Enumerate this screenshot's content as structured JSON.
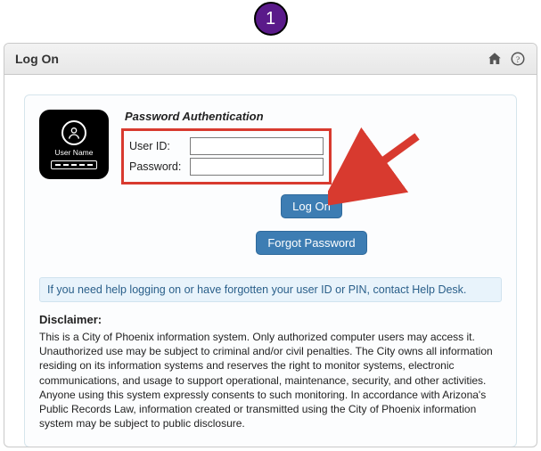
{
  "step_badge": "1",
  "panel": {
    "title": "Log On"
  },
  "user_tile": {
    "label": "User Name"
  },
  "auth": {
    "heading": "Password Authentication",
    "userid_label": "User ID:",
    "userid_value": "",
    "password_label": "Password:",
    "password_value": "",
    "logon_button": "Log On",
    "forgot_button": "Forgot Password"
  },
  "help_text": "If you need help logging on or have forgotten your user ID or PIN, contact Help Desk.",
  "disclaimer": {
    "heading": "Disclaimer:",
    "body": "This is a City of Phoenix information system. Only authorized computer users may access it. Unauthorized use may be subject to criminal and/or civil penalties. The City owns all information residing on its information systems and reserves the right to monitor systems, electronic communications, and usage to support operational, maintenance, security, and other activities. Anyone using this system expressly consents to such monitoring. In accordance with Arizona's Public Records Law, information created or transmitted using the City of Phoenix information system may be subject to public disclosure."
  },
  "colors": {
    "badge_bg": "#5a1a8a",
    "highlight_border": "#d83a2f",
    "button_bg": "#3d7db3",
    "arrow": "#d83a2f"
  }
}
